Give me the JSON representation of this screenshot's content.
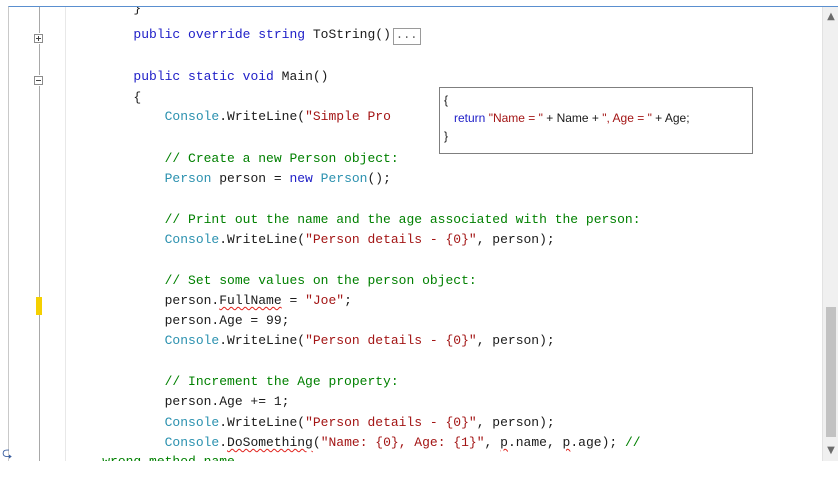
{
  "editor": {
    "lines": [
      [
        {
          "t": "        }",
          "c": ""
        }
      ],
      [
        {
          "t": "        ",
          "c": ""
        },
        {
          "t": "public override string",
          "c": "kw"
        },
        {
          "t": " ToString()",
          "c": ""
        }
      ],
      [
        {
          "t": "",
          "c": ""
        }
      ],
      [
        {
          "t": "        ",
          "c": ""
        },
        {
          "t": "public static void",
          "c": "kw"
        },
        {
          "t": " Main()",
          "c": ""
        }
      ],
      [
        {
          "t": "        {",
          "c": ""
        }
      ],
      [
        {
          "t": "            ",
          "c": ""
        },
        {
          "t": "Console",
          "c": "ty"
        },
        {
          "t": ".WriteLine(",
          "c": ""
        },
        {
          "t": "\"Simple Pro",
          "c": "str"
        }
      ],
      [
        {
          "t": "",
          "c": ""
        }
      ],
      [
        {
          "t": "            ",
          "c": ""
        },
        {
          "t": "// Create a new Person object:",
          "c": "cm"
        }
      ],
      [
        {
          "t": "            ",
          "c": ""
        },
        {
          "t": "Person",
          "c": "ty"
        },
        {
          "t": " person = ",
          "c": ""
        },
        {
          "t": "new",
          "c": "kw"
        },
        {
          "t": " ",
          "c": ""
        },
        {
          "t": "Person",
          "c": "ty"
        },
        {
          "t": "();",
          "c": ""
        }
      ],
      [
        {
          "t": "",
          "c": ""
        }
      ],
      [
        {
          "t": "            ",
          "c": ""
        },
        {
          "t": "// Print out the name and the age associated with the person:",
          "c": "cm"
        }
      ],
      [
        {
          "t": "            ",
          "c": ""
        },
        {
          "t": "Console",
          "c": "ty"
        },
        {
          "t": ".WriteLine(",
          "c": ""
        },
        {
          "t": "\"Person details - {0}\"",
          "c": "str"
        },
        {
          "t": ", person);",
          "c": ""
        }
      ],
      [
        {
          "t": "",
          "c": ""
        }
      ],
      [
        {
          "t": "            ",
          "c": ""
        },
        {
          "t": "// Set some values on the person object:",
          "c": "cm"
        }
      ],
      [
        {
          "t": "            person.",
          "c": ""
        },
        {
          "t": "FullName",
          "c": "squig"
        },
        {
          "t": " = ",
          "c": ""
        },
        {
          "t": "\"Joe\"",
          "c": "str"
        },
        {
          "t": ";",
          "c": ""
        }
      ],
      [
        {
          "t": "            person.Age = 99;",
          "c": ""
        }
      ],
      [
        {
          "t": "            ",
          "c": ""
        },
        {
          "t": "Console",
          "c": "ty"
        },
        {
          "t": ".WriteLine(",
          "c": ""
        },
        {
          "t": "\"Person details - {0}\"",
          "c": "str"
        },
        {
          "t": ", person);",
          "c": ""
        }
      ],
      [
        {
          "t": "",
          "c": ""
        }
      ],
      [
        {
          "t": "            ",
          "c": ""
        },
        {
          "t": "// Increment the Age property:",
          "c": "cm"
        }
      ],
      [
        {
          "t": "            person.Age += 1;",
          "c": ""
        }
      ],
      [
        {
          "t": "            ",
          "c": ""
        },
        {
          "t": "Console",
          "c": "ty"
        },
        {
          "t": ".WriteLine(",
          "c": ""
        },
        {
          "t": "\"Person details - {0}\"",
          "c": "str"
        },
        {
          "t": ", person);",
          "c": ""
        }
      ],
      [
        {
          "t": "            ",
          "c": ""
        },
        {
          "t": "Console",
          "c": "ty"
        },
        {
          "t": ".",
          "c": ""
        },
        {
          "t": "DoSomething",
          "c": "squig"
        },
        {
          "t": "(",
          "c": ""
        },
        {
          "t": "\"Name: {0}, Age: {1}\"",
          "c": "str"
        },
        {
          "t": ", ",
          "c": ""
        },
        {
          "t": "p",
          "c": "squig"
        },
        {
          "t": ".name, ",
          "c": ""
        },
        {
          "t": "p",
          "c": "squig"
        },
        {
          "t": ".age); ",
          "c": ""
        },
        {
          "t": "//",
          "c": "cm"
        }
      ],
      [
        {
          "t": "    ",
          "c": ""
        },
        {
          "t": "wrong method ",
          "c": "cm"
        },
        {
          "t": "name",
          "c": "cm squig"
        }
      ]
    ],
    "collapsed_label": "...",
    "tooltip": {
      "lines": [
        [
          {
            "t": "{",
            "c": ""
          }
        ],
        [
          {
            "t": "   return ",
            "c": "tkw"
          },
          {
            "t": "\"Name = \"",
            "c": "tstr"
          },
          {
            "t": " + Name + ",
            "c": ""
          },
          {
            "t": "\", Age = \"",
            "c": "tstr"
          },
          {
            "t": " + Age;",
            "c": ""
          }
        ],
        [
          {
            "t": "}",
            "c": ""
          }
        ]
      ]
    },
    "icons": {
      "scroll_up": "▲",
      "scroll_down": "▼",
      "glyph": "⮎"
    }
  }
}
